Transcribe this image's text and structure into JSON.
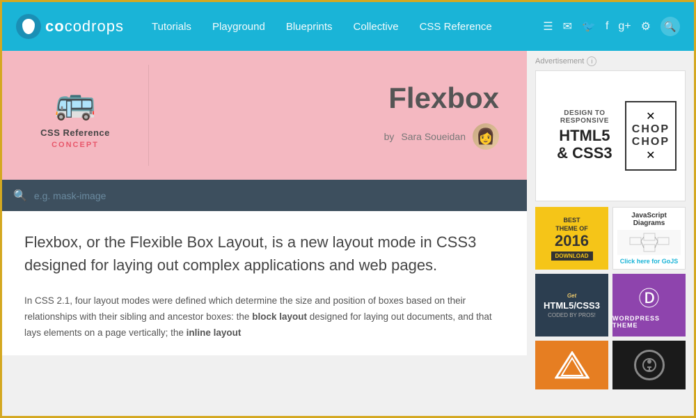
{
  "header": {
    "logo_text": "codrops",
    "nav": {
      "items": [
        {
          "label": "Tutorials",
          "id": "tutorials"
        },
        {
          "label": "Playground",
          "id": "playground"
        },
        {
          "label": "Blueprints",
          "id": "blueprints"
        },
        {
          "label": "Collective",
          "id": "collective"
        },
        {
          "label": "CSS Reference",
          "id": "css-reference"
        }
      ]
    },
    "icons": [
      "rss",
      "email",
      "twitter",
      "facebook",
      "google-plus",
      "github",
      "search"
    ]
  },
  "hero": {
    "badge_icon": "🚌",
    "badge_title": "CSS Reference",
    "badge_subtitle": "CONCEPT",
    "article_title": "Flexbox",
    "author_by": "by",
    "author_name": "Sara Soueidan",
    "author_avatar": "👩"
  },
  "search": {
    "placeholder": "e.g. mask-image"
  },
  "article": {
    "intro": "Flexbox, or the Flexible Box Layout, is a new layout mode in CSS3 designed for laying out complex applications and web pages.",
    "body_p1": "In CSS 2.1, four layout modes were defined which determine the size and position of boxes based on their relationships with their sibling and ancestor boxes: the",
    "body_bold1": "block layout",
    "body_p1b": "designed for laying out documents, and that lays elements on a page vertically; the",
    "body_bold2": "inline layout"
  },
  "sidebar": {
    "ad_label": "Advertisement",
    "ad_info": "i",
    "ad_main": {
      "left_subtitle": "DESIGN TO RESPONSIVE",
      "left_title": "HTML5",
      "left_and": "& CSS3",
      "right_symbol_top": "✕",
      "right_title": "CHOP",
      "right_subtitle": "CHOP",
      "right_symbol_bottom": "✕"
    },
    "ad_best2016": {
      "best": "BEST",
      "theme_of": "THEME OF",
      "year": "2016",
      "download": "DOWNLOAD"
    },
    "ad_gojs": {
      "title": "JavaScript Diagrams",
      "link": "Click here for GoJS"
    },
    "ad_responsive": {
      "get": "Get",
      "title": "HTML5/CSS3",
      "sub": "CODED BY PROS!"
    },
    "ad_wp": {
      "icon": "Ⓓ",
      "text": "WORDPRESS THEME"
    }
  }
}
